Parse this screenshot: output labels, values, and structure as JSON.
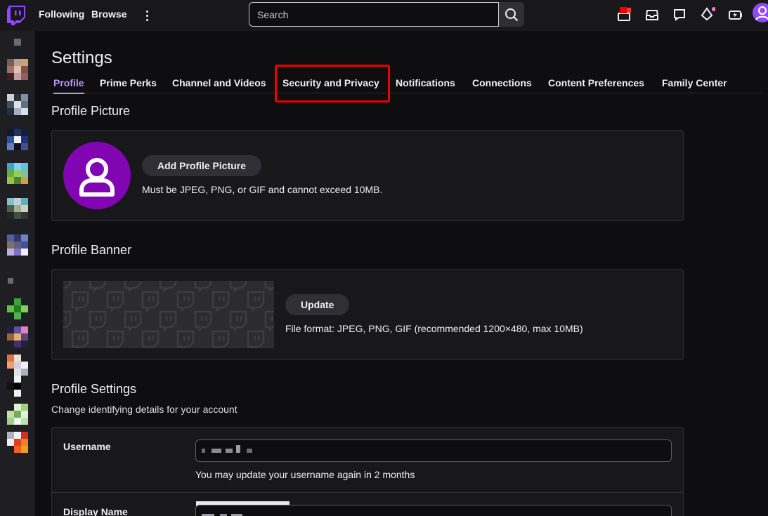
{
  "nav": {
    "following": "Following",
    "browse": "Browse",
    "search_placeholder": "Search"
  },
  "settings": {
    "title": "Settings",
    "tabs": [
      {
        "label": "Profile",
        "active": true
      },
      {
        "label": "Prime Perks"
      },
      {
        "label": "Channel and Videos"
      },
      {
        "label": "Security and Privacy",
        "highlighted": true
      },
      {
        "label": "Notifications"
      },
      {
        "label": "Connections"
      },
      {
        "label": "Content Preferences"
      },
      {
        "label": "Family Center"
      }
    ]
  },
  "profile_picture": {
    "title": "Profile Picture",
    "button": "Add Profile Picture",
    "hint": "Must be JPEG, PNG, or GIF and cannot exceed 10MB."
  },
  "profile_banner": {
    "title": "Profile Banner",
    "button": "Update",
    "hint": "File format: JPEG, PNG, GIF (recommended 1200×480, max 10MB)"
  },
  "profile_settings": {
    "title": "Profile Settings",
    "subtitle": "Change identifying details for your account",
    "username_label": "Username",
    "username_hint": "You may update your username again in 2 months",
    "display_name_label": "Display Name"
  },
  "colors": {
    "accent": "#bf94ff",
    "brand": "#9146ff",
    "highlight": "#e00000",
    "avatar_bg": "#8205b4"
  }
}
